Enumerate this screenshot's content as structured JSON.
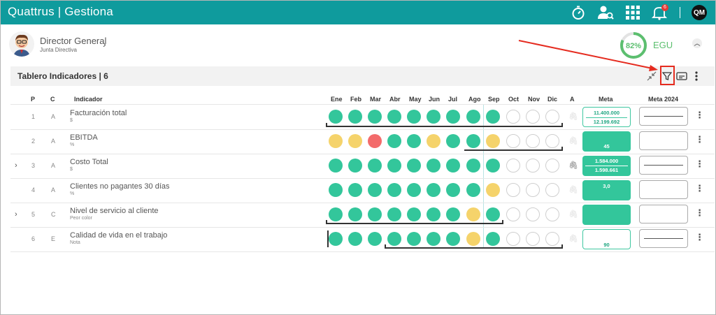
{
  "app": {
    "brand": "Quattrus | Gestiona",
    "notif_count": "6",
    "user_initials": "QM"
  },
  "user": {
    "name": "Director General",
    "role": "Junta Directiva"
  },
  "egu": {
    "percent": "82%",
    "label": "EGU",
    "value": 0.82
  },
  "panel": {
    "title": "Tablero Indicadores | 6"
  },
  "columns": {
    "p": "P",
    "c": "C",
    "indicador": "Indicador",
    "months": [
      "Ene",
      "Feb",
      "Mar",
      "Abr",
      "May",
      "Jun",
      "Jul",
      "Ago",
      "Sep",
      "Oct",
      "Nov",
      "Dic"
    ],
    "a": "A",
    "meta": "Meta",
    "meta2024": "Meta 2024"
  },
  "rows": [
    {
      "p": "1",
      "c": "A",
      "name": "Facturación total",
      "unit": "$",
      "expandable": false,
      "status": [
        "g",
        "g",
        "g",
        "g",
        "g",
        "g",
        "g",
        "g",
        "g",
        "e",
        "e",
        "e"
      ],
      "meta": [
        "11.400.000",
        "12.199.692"
      ],
      "meta_style": "outline",
      "meta2024": "line",
      "attach": false
    },
    {
      "p": "2",
      "c": "A",
      "name": "EBITDA",
      "unit": "%",
      "expandable": false,
      "status": [
        "y",
        "y",
        "r",
        "g",
        "g",
        "y",
        "g",
        "g",
        "y",
        "e",
        "e",
        "e"
      ],
      "meta": [
        "45"
      ],
      "meta_style": "fill",
      "meta2024": "blank",
      "attach": false
    },
    {
      "p": "3",
      "c": "A",
      "name": "Costo Total",
      "unit": "$",
      "expandable": true,
      "status": [
        "g",
        "g",
        "g",
        "g",
        "g",
        "g",
        "g",
        "g",
        "g",
        "e",
        "e",
        "e"
      ],
      "meta": [
        "1.584.000",
        "1.598.661"
      ],
      "meta_style": "fill",
      "meta2024": "line",
      "attach": true
    },
    {
      "p": "4",
      "c": "A",
      "name": "Clientes no pagantes 30 días",
      "unit": "%",
      "expandable": false,
      "status": [
        "g",
        "g",
        "g",
        "g",
        "g",
        "g",
        "g",
        "g",
        "y",
        "e",
        "e",
        "e"
      ],
      "meta": [
        "3,0"
      ],
      "meta_style": "fill",
      "meta2024": "blank",
      "attach": false
    },
    {
      "p": "5",
      "c": "C",
      "name": "Nivel de servicio al cliente",
      "unit": "Peor color",
      "expandable": true,
      "status": [
        "g",
        "g",
        "g",
        "g",
        "g",
        "g",
        "g",
        "y",
        "g",
        "e",
        "e",
        "e"
      ],
      "meta": [
        ""
      ],
      "meta_style": "fill",
      "meta2024": "blank",
      "attach": false
    },
    {
      "p": "6",
      "c": "E",
      "name": "Calidad de vida en el trabajo",
      "unit": "Nota",
      "expandable": false,
      "status": [
        "g",
        "g",
        "g",
        "g",
        "g",
        "g",
        "g",
        "y",
        "g",
        "e",
        "e",
        "e"
      ],
      "meta": [
        "90"
      ],
      "meta_style": "outline",
      "meta2024": "line",
      "attach": false
    }
  ],
  "icons": [
    "stopwatch-icon",
    "user-search-icon",
    "apps-grid-icon",
    "bell-icon",
    "shrink-icon",
    "filter-icon",
    "card-view-icon",
    "kebab-icon"
  ],
  "colors": {
    "topbar": "#0f9b9d",
    "green": "#33c69b",
    "yellow": "#f5d36b",
    "red": "#f36b6b",
    "annotation": "#e52b1f"
  }
}
